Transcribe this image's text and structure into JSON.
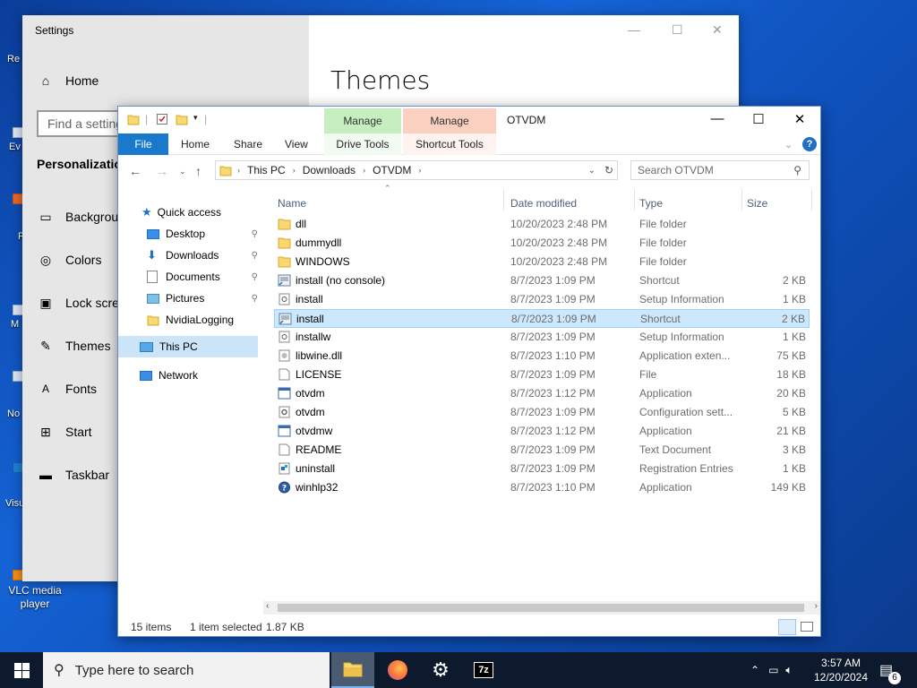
{
  "desktop": {
    "fragments": [
      "Re",
      "Ev",
      "F",
      "M",
      "No",
      "Visu"
    ],
    "vlc_label": "VLC media player"
  },
  "settings": {
    "window_title": "Settings",
    "page_heading": "Themes",
    "search_placeholder": "Find a setting",
    "section_title": "Personalization",
    "home_label": "Home",
    "nav_items": [
      {
        "label": "Background",
        "icon": "image-icon"
      },
      {
        "label": "Colors",
        "icon": "palette-icon"
      },
      {
        "label": "Lock screen",
        "icon": "lock-screen-icon"
      },
      {
        "label": "Themes",
        "icon": "themes-icon"
      },
      {
        "label": "Fonts",
        "icon": "fonts-icon"
      },
      {
        "label": "Start",
        "icon": "start-icon"
      },
      {
        "label": "Taskbar",
        "icon": "taskbar-icon"
      }
    ]
  },
  "explorer": {
    "title": "OTVDM",
    "context_tabs": [
      {
        "label": "Manage",
        "sub": "Drive Tools",
        "color": "#c6efc0"
      },
      {
        "label": "Manage",
        "sub": "Shortcut Tools",
        "color": "#fcd0c0"
      }
    ],
    "ribbon_tabs": [
      "File",
      "Home",
      "Share",
      "View"
    ],
    "address": [
      "This PC",
      "Downloads",
      "OTVDM"
    ],
    "search_placeholder": "Search OTVDM",
    "columns": {
      "name": "Name",
      "date": "Date modified",
      "type": "Type",
      "size": "Size"
    },
    "nav_pane": {
      "quick_access": "Quick access",
      "pinned": [
        "Desktop",
        "Downloads",
        "Documents",
        "Pictures"
      ],
      "other": "NvidiaLogging",
      "this_pc": "This PC",
      "network": "Network"
    },
    "files": [
      {
        "name": "dll",
        "date": "10/20/2023 2:48 PM",
        "type": "File folder",
        "size": "",
        "icon": "folder"
      },
      {
        "name": "dummydll",
        "date": "10/20/2023 2:48 PM",
        "type": "File folder",
        "size": "",
        "icon": "folder"
      },
      {
        "name": "WINDOWS",
        "date": "10/20/2023 2:48 PM",
        "type": "File folder",
        "size": "",
        "icon": "folder"
      },
      {
        "name": "install (no console)",
        "date": "8/7/2023 1:09 PM",
        "type": "Shortcut",
        "size": "2 KB",
        "icon": "shortcut"
      },
      {
        "name": "install",
        "date": "8/7/2023 1:09 PM",
        "type": "Setup Information",
        "size": "1 KB",
        "icon": "inf"
      },
      {
        "name": "install",
        "date": "8/7/2023 1:09 PM",
        "type": "Shortcut",
        "size": "2 KB",
        "icon": "shortcut",
        "selected": true
      },
      {
        "name": "installw",
        "date": "8/7/2023 1:09 PM",
        "type": "Setup Information",
        "size": "1 KB",
        "icon": "inf"
      },
      {
        "name": "libwine.dll",
        "date": "8/7/2023 1:10 PM",
        "type": "Application exten...",
        "size": "75 KB",
        "icon": "dll"
      },
      {
        "name": "LICENSE",
        "date": "8/7/2023 1:09 PM",
        "type": "File",
        "size": "18 KB",
        "icon": "file"
      },
      {
        "name": "otvdm",
        "date": "8/7/2023 1:12 PM",
        "type": "Application",
        "size": "20 KB",
        "icon": "app"
      },
      {
        "name": "otvdm",
        "date": "8/7/2023 1:09 PM",
        "type": "Configuration sett...",
        "size": "5 KB",
        "icon": "config"
      },
      {
        "name": "otvdmw",
        "date": "8/7/2023 1:12 PM",
        "type": "Application",
        "size": "21 KB",
        "icon": "app"
      },
      {
        "name": "README",
        "date": "8/7/2023 1:09 PM",
        "type": "Text Document",
        "size": "3 KB",
        "icon": "file"
      },
      {
        "name": "uninstall",
        "date": "8/7/2023 1:09 PM",
        "type": "Registration Entries",
        "size": "1 KB",
        "icon": "reg"
      },
      {
        "name": "winhlp32",
        "date": "8/7/2023 1:10 PM",
        "type": "Application",
        "size": "149 KB",
        "icon": "help"
      }
    ],
    "status": {
      "count": "15 items",
      "selection": "1 item selected",
      "size": "1.87 KB"
    }
  },
  "taskbar": {
    "search_placeholder": "Type here to search",
    "time": "3:57 AM",
    "date": "12/20/2024",
    "notification_count": "6",
    "seven_zip": "7z"
  }
}
